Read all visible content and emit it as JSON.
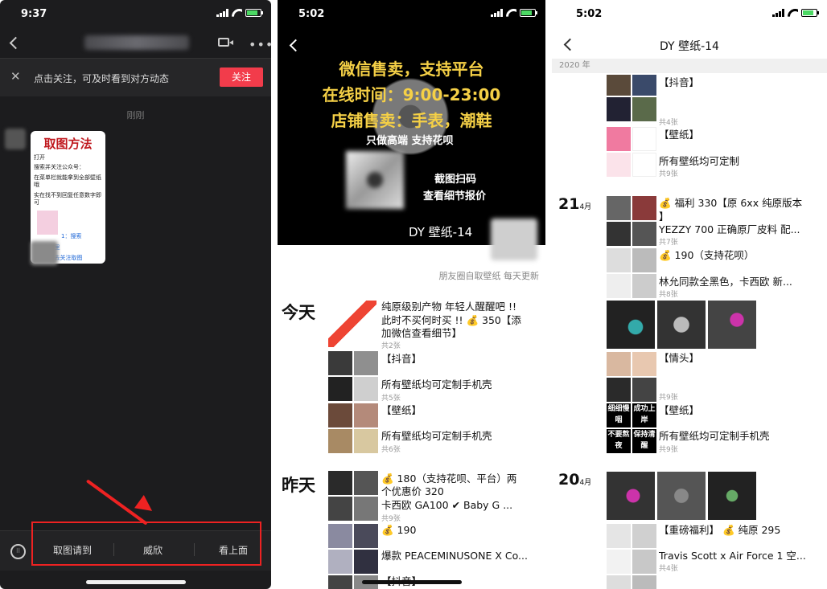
{
  "panel1": {
    "time": "9:37",
    "follow_tip": "点击关注，可及时看到对方动态",
    "follow_button": "关注",
    "message_time": "刚刚",
    "card": {
      "title": "取图方法",
      "line1": "打开",
      "line2": "搜索并关注公众号：",
      "line3": "在菜单栏就能拿到全部壁纸哦",
      "line4": "实在找不到回复任意数字即可",
      "search": "1：搜索",
      "step2": "2：点这里",
      "step3": "3：点选去关注取图"
    },
    "menu": [
      "取图请到",
      "威欣",
      "看上面"
    ]
  },
  "panel2": {
    "time": "5:02",
    "hero": {
      "line1": "微信售卖，支持平台",
      "line2": "在线时间：9:00-23:00",
      "line3": "店铺售卖：手表，潮鞋",
      "line4": "只做高端 支持花呗",
      "scan1": "截图扫码",
      "scan2": "查看细节报价",
      "name": "DY 壁纸-14"
    },
    "tagline": "朋友圈自取壁纸 每天更新",
    "today_label": "今天",
    "yesterday_label": "昨天",
    "posts": [
      {
        "text1": "纯原级别产物 年轻人醒醒吧 !!",
        "text2": "此时不买何时买 !! 💰 350【添",
        "text3": "加微信查看细节】",
        "count": "共2张"
      },
      {
        "text1": "【抖音】",
        "text2": "所有壁纸均可定制手机壳",
        "count": "共5张"
      },
      {
        "text1": "【壁纸】",
        "text2": "所有壁纸均可定制手机壳",
        "count": "共6张"
      },
      {
        "text1": "💰 180（支持花呗、平台）两",
        "text2": "个优惠价 320",
        "text3": "卡西欧 GA100 ✔ Baby G ...",
        "count": "共9张"
      },
      {
        "text1": "💰 190",
        "text2": "爆款 PEACEMINUSONE X Co...",
        "count": ""
      },
      {
        "text1": "【抖音】",
        "count": ""
      }
    ]
  },
  "panel3": {
    "time": "5:02",
    "title": "DY 壁纸-14",
    "year": "2020 年",
    "dates": [
      {
        "day": "21",
        "month": "4月"
      },
      {
        "day": "20",
        "month": "4月"
      }
    ],
    "entries": [
      {
        "text1": "【抖音】",
        "count": "共4张"
      },
      {
        "text1": "【壁纸】",
        "text2": "所有壁纸均可定制",
        "count": "共9张"
      },
      {
        "text1": "💰 福利 330【原 6xx 纯原版本",
        "text2": "】",
        "text3": "YEZZY 700 正确原厂皮料 配...",
        "count": "共7张"
      },
      {
        "text1": "💰 190（支持花呗）",
        "text2": "林允同款全黑色，卡西欧 新...",
        "count": "共8张"
      },
      {
        "text1": "【情头】",
        "count": "共9张"
      },
      {
        "text1": "【壁纸】",
        "text2": "所有壁纸均可定制手机壳",
        "count": "共9张"
      },
      {
        "text1": "【重磅福利】 💰 纯原 295",
        "text2": "Travis Scott x Air Force 1 空...",
        "count": "共4张"
      }
    ],
    "tile_text": {
      "a": "细细慢咽",
      "b": "成功上岸",
      "c": "不要熬夜",
      "d": "保持清醒"
    }
  },
  "colors": {
    "accent_red": "#f23c4b",
    "hero_yellow": "#f5d046"
  }
}
